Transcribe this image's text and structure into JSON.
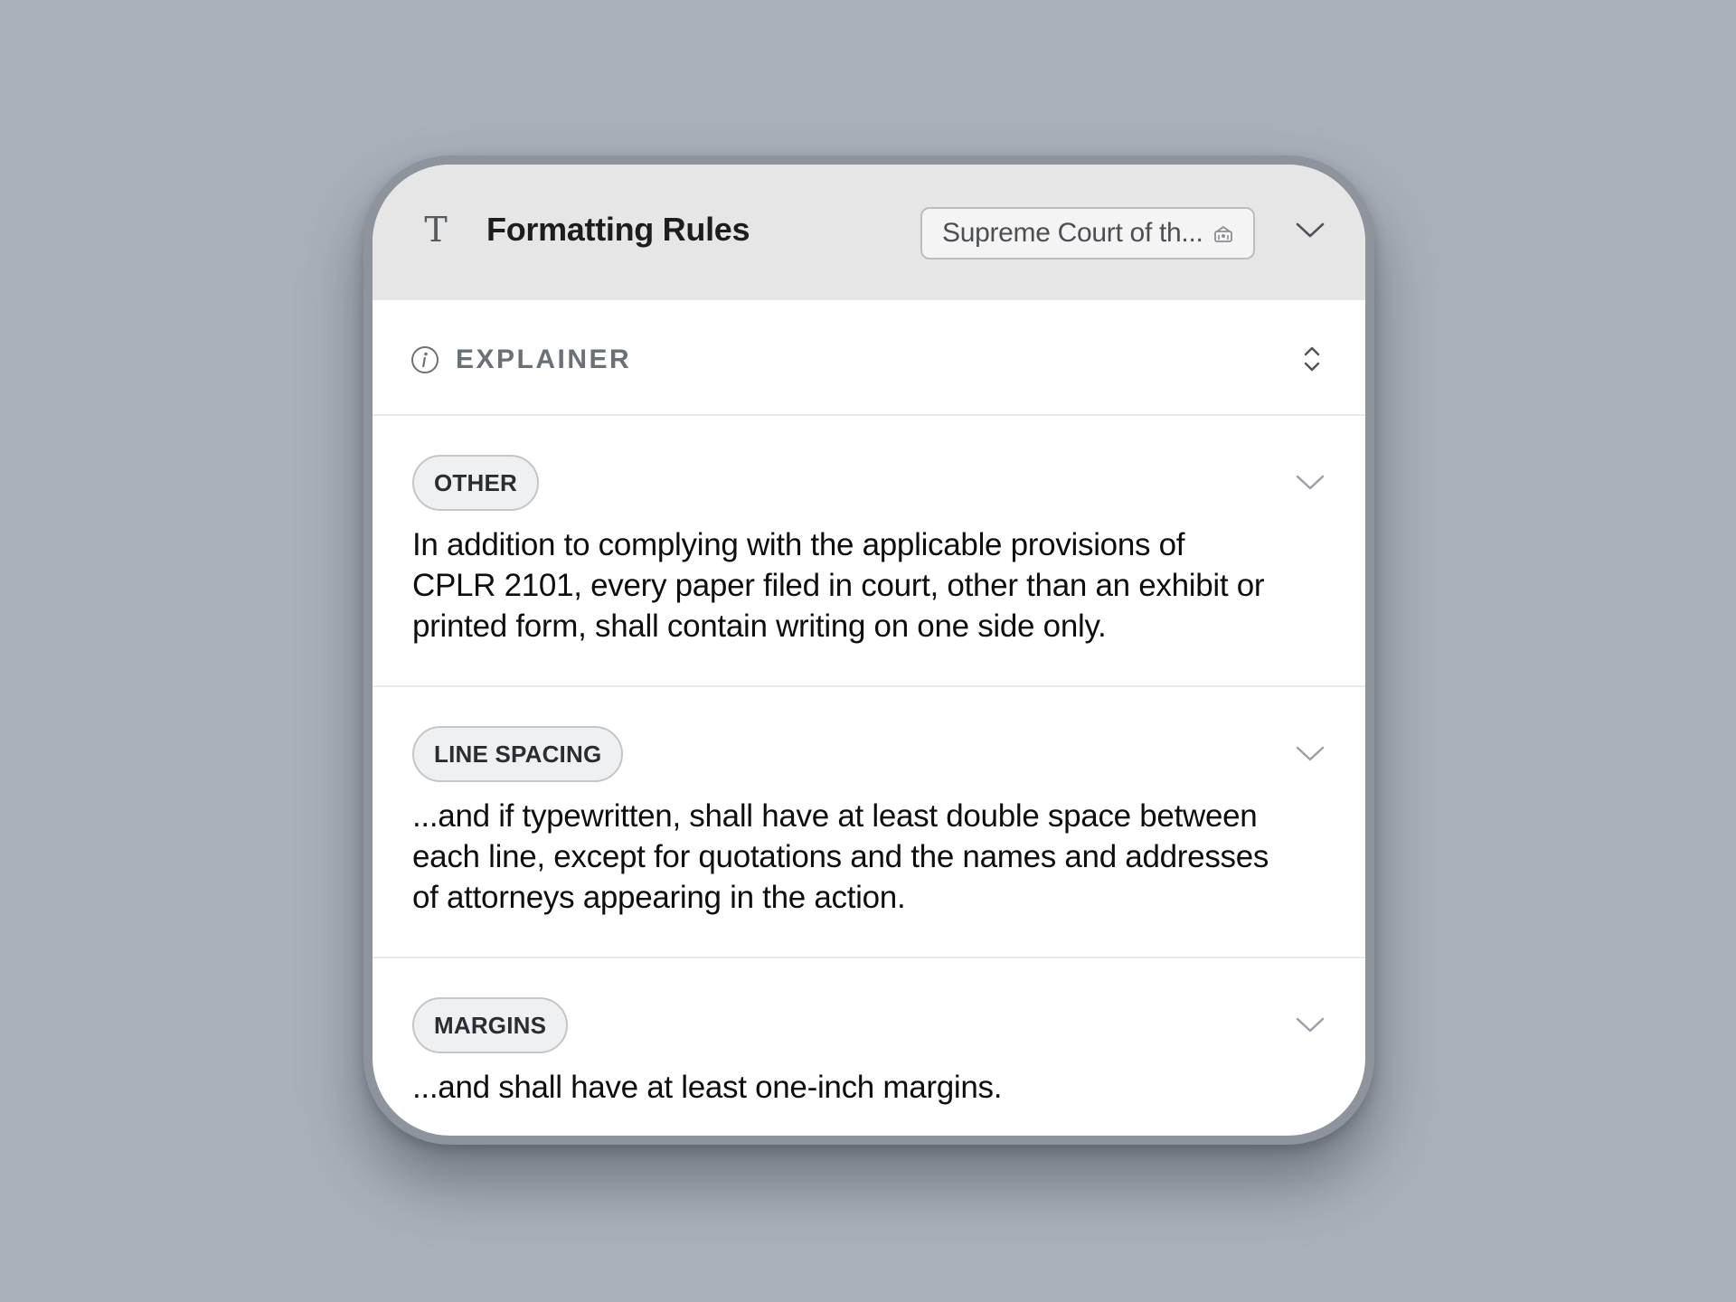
{
  "header": {
    "title": "Formatting Rules",
    "court_select_value": "Supreme Court of th...",
    "icons": {
      "format": "text-format-icon",
      "court": "courthouse-icon",
      "expand": "chevron-down-icon"
    }
  },
  "explainer": {
    "label": "EXPLAINER",
    "icons": {
      "info": "info-icon",
      "toggle": "chevron-up-down-icon"
    }
  },
  "rules": [
    {
      "tag": "OTHER",
      "text": "In addition to complying with the applicable provisions of CPLR 2101, every paper filed in court, other than an exhibit or printed form, shall contain writing on one side only."
    },
    {
      "tag": "LINE SPACING",
      "text": "...and if typewritten, shall have at least double space between each line, except for quotations and the names and addresses of attorneys appearing in the action."
    },
    {
      "tag": "MARGINS",
      "text": "...and shall have at least one-inch margins."
    }
  ],
  "colors": {
    "background": "#aab1ba",
    "header": "#e6e6e6",
    "badge_fill": "#eef0f2",
    "muted_label": "#6b7178"
  }
}
